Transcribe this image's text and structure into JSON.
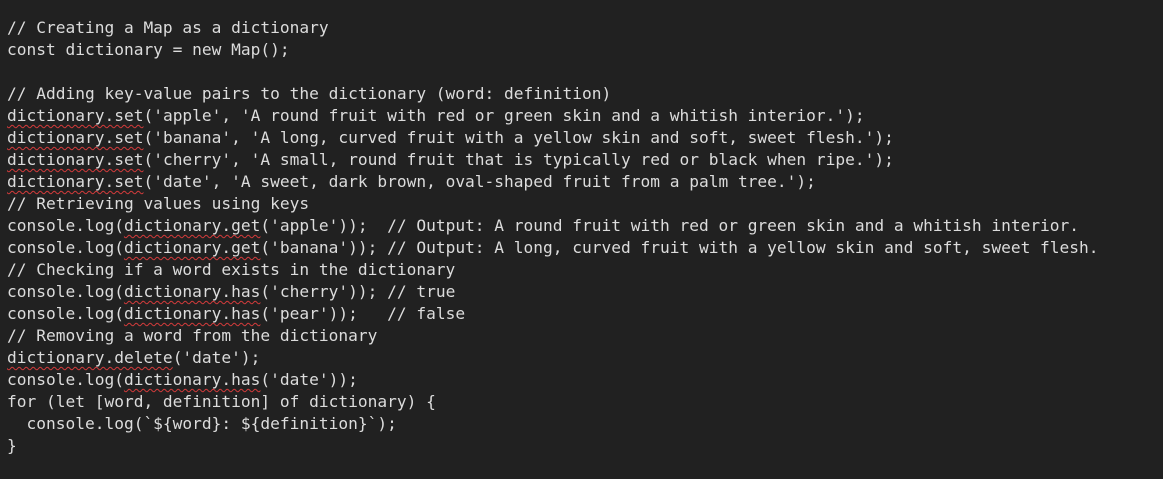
{
  "editor": {
    "lines": [
      {
        "segments": [
          {
            "text": "// Creating a Map as a dictionary"
          }
        ]
      },
      {
        "segments": [
          {
            "text": "const dictionary = new Map();"
          }
        ]
      },
      {
        "segments": [
          {
            "text": ""
          }
        ]
      },
      {
        "segments": [
          {
            "text": "// Adding key-value pairs to the dictionary (word: definition)"
          }
        ]
      },
      {
        "segments": [
          {
            "text": "dictionary.set",
            "spell": true
          },
          {
            "text": "('apple', 'A round fruit with red or green skin and a whitish interior.');"
          }
        ]
      },
      {
        "segments": [
          {
            "text": "dictionary.set",
            "spell": true
          },
          {
            "text": "('banana', 'A long, curved fruit with a yellow skin and soft, sweet flesh.');"
          }
        ]
      },
      {
        "segments": [
          {
            "text": "dictionary.set",
            "spell": true
          },
          {
            "text": "('cherry', 'A small, round fruit that is typically red or black when ripe.');"
          }
        ]
      },
      {
        "segments": [
          {
            "text": "dictionary.set",
            "spell": true
          },
          {
            "text": "('date', 'A sweet, dark brown, oval-shaped fruit from a palm tree.');"
          }
        ]
      },
      {
        "segments": [
          {
            "text": "// Retrieving values using keys"
          }
        ]
      },
      {
        "segments": [
          {
            "text": "console.log("
          },
          {
            "text": "dictionary.get",
            "spell": true
          },
          {
            "text": "('apple'));  // Output: A round fruit with red or green skin and a whitish interior."
          }
        ]
      },
      {
        "segments": [
          {
            "text": "console.log("
          },
          {
            "text": "dictionary.get",
            "spell": true
          },
          {
            "text": "('banana')); // Output: A long, curved fruit with a yellow skin and soft, sweet flesh."
          }
        ]
      },
      {
        "segments": [
          {
            "text": "// Checking if a word exists in the dictionary"
          }
        ]
      },
      {
        "segments": [
          {
            "text": "console.log("
          },
          {
            "text": "dictionary.has",
            "spell": true
          },
          {
            "text": "('cherry')); // true"
          }
        ]
      },
      {
        "segments": [
          {
            "text": "console.log("
          },
          {
            "text": "dictionary.has",
            "spell": true
          },
          {
            "text": "('pear'));   // false"
          }
        ]
      },
      {
        "segments": [
          {
            "text": "// Removing a word from the dictionary"
          }
        ]
      },
      {
        "segments": [
          {
            "text": "dictionary.delete",
            "spell": true
          },
          {
            "text": "('date');"
          }
        ]
      },
      {
        "segments": [
          {
            "text": "console.log("
          },
          {
            "text": "dictionary.has",
            "spell": true
          },
          {
            "text": "('date'));"
          }
        ]
      },
      {
        "segments": [
          {
            "text": "for (let [word, definition] of dictionary) {"
          }
        ]
      },
      {
        "segments": [
          {
            "text": "  console.log(`${word}: ${definition}`);"
          }
        ]
      },
      {
        "segments": [
          {
            "text": "}"
          }
        ]
      }
    ]
  },
  "colors": {
    "background": "#212121",
    "text": "#dcdcdc",
    "spellcheck_underline": "#d43b3b"
  }
}
